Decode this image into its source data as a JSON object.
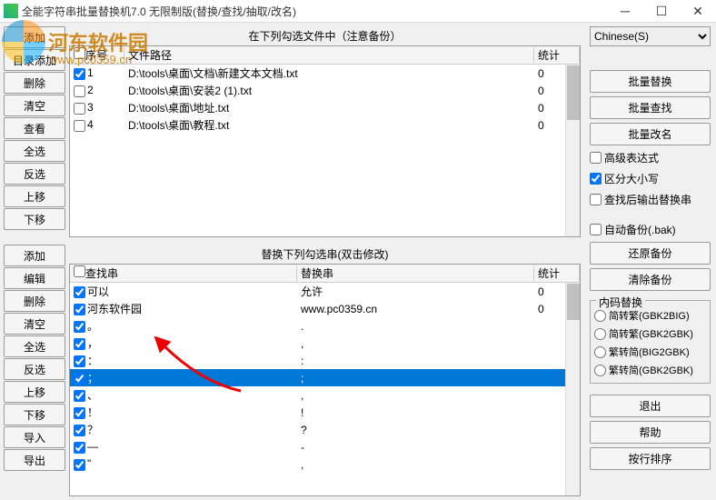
{
  "window": {
    "title": "全能字符串批量替换机7.0 无限制版(替换/查找/抽取/改名)"
  },
  "watermark": {
    "text": "河东软件园",
    "url": "www.pc0359.cn"
  },
  "file_section": {
    "title": "在下列勾选文件中（注意备份）",
    "buttons": [
      "添加",
      "目录添加",
      "删除",
      "清空",
      "查看",
      "全选",
      "反选",
      "上移",
      "下移"
    ],
    "columns": {
      "seq": "序号",
      "path": "文件路径",
      "stat": "统计"
    },
    "rows": [
      {
        "checked": true,
        "seq": "1",
        "path": "D:\\tools\\桌面\\文档\\新建文本文档.txt",
        "stat": "0"
      },
      {
        "checked": false,
        "seq": "2",
        "path": "D:\\tools\\桌面\\安装2 (1).txt",
        "stat": "0"
      },
      {
        "checked": false,
        "seq": "3",
        "path": "D:\\tools\\桌面\\地址.txt",
        "stat": "0"
      },
      {
        "checked": false,
        "seq": "4",
        "path": "D:\\tools\\桌面\\教程.txt",
        "stat": "0"
      }
    ]
  },
  "replace_section": {
    "title": "替换下列勾选串(双击修改)",
    "buttons": [
      "添加",
      "编辑",
      "删除",
      "清空",
      "全选",
      "反选",
      "上移",
      "下移",
      "导入",
      "导出"
    ],
    "columns": {
      "find": "查找串",
      "replace": "替换串",
      "stat": "统计"
    },
    "rows": [
      {
        "checked": true,
        "find": "可以",
        "replace": "允许",
        "stat": "0",
        "sel": false
      },
      {
        "checked": true,
        "find": "河东软件园",
        "replace": "www.pc0359.cn",
        "stat": "0",
        "sel": false
      },
      {
        "checked": true,
        "find": "。",
        "replace": ".",
        "stat": "",
        "sel": false
      },
      {
        "checked": true,
        "find": "，",
        "replace": ",",
        "stat": "",
        "sel": false
      },
      {
        "checked": true,
        "find": "：",
        "replace": ":",
        "stat": "",
        "sel": false
      },
      {
        "checked": true,
        "find": "；",
        "replace": ";",
        "stat": "",
        "sel": true
      },
      {
        "checked": true,
        "find": "、",
        "replace": ",",
        "stat": "",
        "sel": false
      },
      {
        "checked": true,
        "find": "！",
        "replace": "!",
        "stat": "",
        "sel": false
      },
      {
        "checked": true,
        "find": "？",
        "replace": "?",
        "stat": "",
        "sel": false
      },
      {
        "checked": true,
        "find": "—",
        "replace": "-",
        "stat": "",
        "sel": false
      },
      {
        "checked": true,
        "find": "\"",
        "replace": ",",
        "stat": "",
        "sel": false
      }
    ]
  },
  "right": {
    "language_options": [
      "Chinese(S)"
    ],
    "language_selected": "Chinese(S)",
    "batch_replace": "批量替换",
    "batch_find": "批量查找",
    "batch_rename": "批量改名",
    "adv_regex": "高级表达式",
    "adv_regex_checked": false,
    "case_sensitive": "区分大小写",
    "case_sensitive_checked": true,
    "output_after_find": "查找后输出替换串",
    "output_after_find_checked": false,
    "auto_backup": "自动备份(.bak)",
    "auto_backup_checked": false,
    "restore_backup": "还原备份",
    "clear_backup": "清除备份",
    "encode_group": "内码替换",
    "encode_options": [
      {
        "label": "简转繁(GBK2BIG)",
        "checked": false
      },
      {
        "label": "简转繁(GBK2GBK)",
        "checked": false
      },
      {
        "label": "繁转简(BIG2GBK)",
        "checked": false
      },
      {
        "label": "繁转简(GBK2GBK)",
        "checked": false
      }
    ],
    "exit": "退出",
    "help": "帮助",
    "sort_by_line": "按行排序"
  }
}
